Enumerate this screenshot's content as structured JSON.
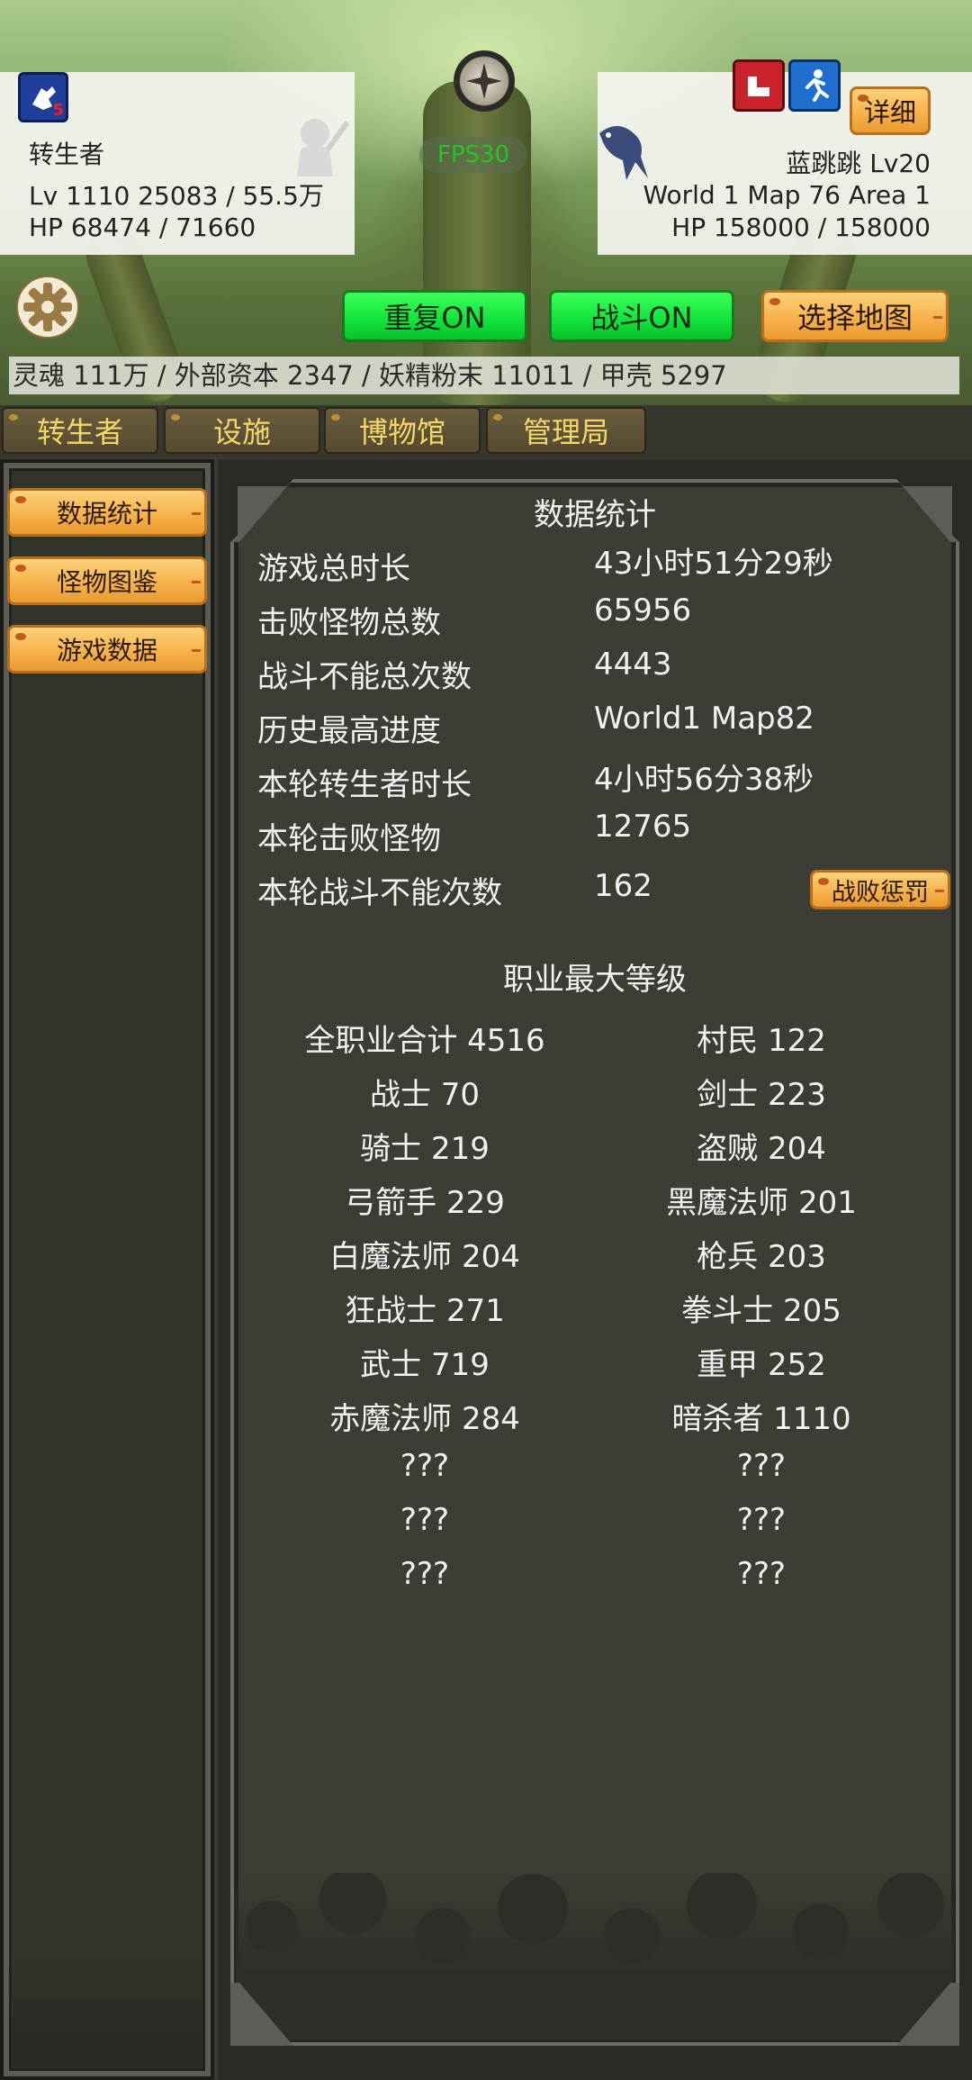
{
  "player": {
    "name": "转生者",
    "level_line": "Lv 1110 25083 / 55.5万",
    "hp_line": "HP 68474 / 71660",
    "job_icon": "fist-job-icon",
    "job_badge": "5"
  },
  "fps": "FPS30",
  "enemy": {
    "name_line": "蓝跳跳 Lv20",
    "location_line": "World 1 Map 76 Area 1",
    "hp_line": "HP 158000 / 158000",
    "detail_label": "详细",
    "status_icons": [
      "muscle-icon",
      "running-icon"
    ]
  },
  "controls": {
    "repeat_label": "重复ON",
    "battle_label": "战斗ON",
    "select_map_label": "选择地图"
  },
  "resources": "灵魂 111万 / 外部资本 2347 / 妖精粉末 11011 / 甲壳 5297",
  "tabs": [
    "转生者",
    "设施",
    "博物馆",
    "管理局"
  ],
  "side_menu": [
    "数据统计",
    "怪物图鉴",
    "游戏数据"
  ],
  "stats": {
    "title": "数据统计",
    "rows": [
      {
        "label": "游戏总时长",
        "value": "43小时51分29秒"
      },
      {
        "label": "击败怪物总数",
        "value": "65956"
      },
      {
        "label": "战斗不能总次数",
        "value": "4443"
      },
      {
        "label": "历史最高进度",
        "value": "World1 Map82"
      },
      {
        "label": "本轮转生者时长",
        "value": "4小时56分38秒"
      },
      {
        "label": "本轮击败怪物",
        "value": "12765"
      },
      {
        "label": "本轮战斗不能次数",
        "value": "162"
      }
    ],
    "punish_label": "战败惩罚"
  },
  "jobs": {
    "title": "职业最大等级",
    "rows": [
      [
        "全职业合计 4516",
        "村民 122"
      ],
      [
        "战士 70",
        "剑士 223"
      ],
      [
        "骑士 219",
        "盗贼 204"
      ],
      [
        "弓箭手 229",
        "黑魔法师 201"
      ],
      [
        "白魔法师 204",
        "枪兵 203"
      ],
      [
        "狂战士 271",
        "拳斗士 205"
      ],
      [
        "武士 719",
        "重甲 252"
      ],
      [
        "赤魔法师 284",
        "暗杀者 1110"
      ],
      [
        "???",
        "???"
      ],
      [
        "???",
        "???"
      ],
      [
        "???",
        "???"
      ]
    ]
  }
}
